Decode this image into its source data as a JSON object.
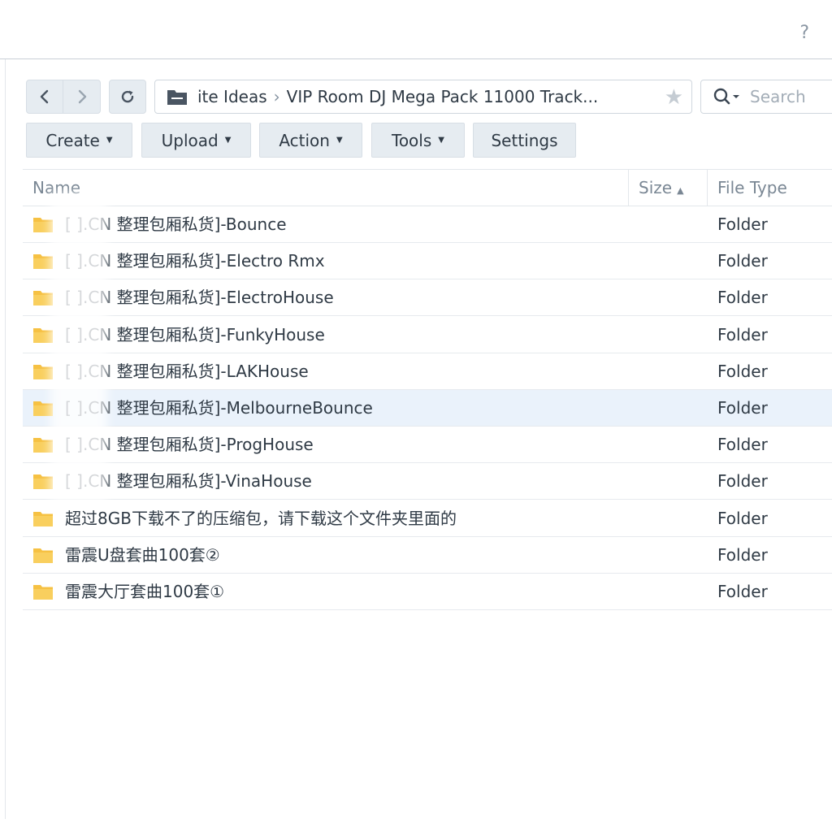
{
  "header": {
    "help_label": "?"
  },
  "nav": {
    "breadcrumb": [
      "ite Ideas",
      "VIP Room DJ Mega Pack 11000 Track..."
    ],
    "breadcrumb_sep": "›",
    "search_placeholder": "Search"
  },
  "toolbar": {
    "create": "Create",
    "upload": "Upload",
    "action": "Action",
    "tools": "Tools",
    "settings": "Settings"
  },
  "columns": {
    "name": "Name",
    "size": "Size",
    "file_type": "File Type"
  },
  "rows": [
    {
      "name": "[    ].CN 整理包厢私货]-Bounce",
      "type": "Folder"
    },
    {
      "name": "[    ].CN 整理包厢私货]-Electro Rmx",
      "type": "Folder"
    },
    {
      "name": "[    ].CN 整理包厢私货]-ElectroHouse",
      "type": "Folder"
    },
    {
      "name": "[    ].CN 整理包厢私货]-FunkyHouse",
      "type": "Folder"
    },
    {
      "name": "[    ].CN 整理包厢私货]-LAKHouse",
      "type": "Folder"
    },
    {
      "name": "[    ].CN 整理包厢私货]-MelbourneBounce",
      "type": "Folder"
    },
    {
      "name": "[    ].CN 整理包厢私货]-ProgHouse",
      "type": "Folder"
    },
    {
      "name": "[    ].CN 整理包厢私货]-VinaHouse",
      "type": "Folder"
    },
    {
      "name": "超过8GB下载不了的压缩包，请下载这个文件夹里面的",
      "type": "Folder"
    },
    {
      "name": "雷震U盘套曲100套②",
      "type": "Folder"
    },
    {
      "name": "雷震大厅套曲100套①",
      "type": "Folder"
    }
  ],
  "selected_row": 5,
  "colors": {
    "folder": "#f6c143",
    "selected_row": "#eaf2fb",
    "button_bg": "#e6ecf1"
  }
}
